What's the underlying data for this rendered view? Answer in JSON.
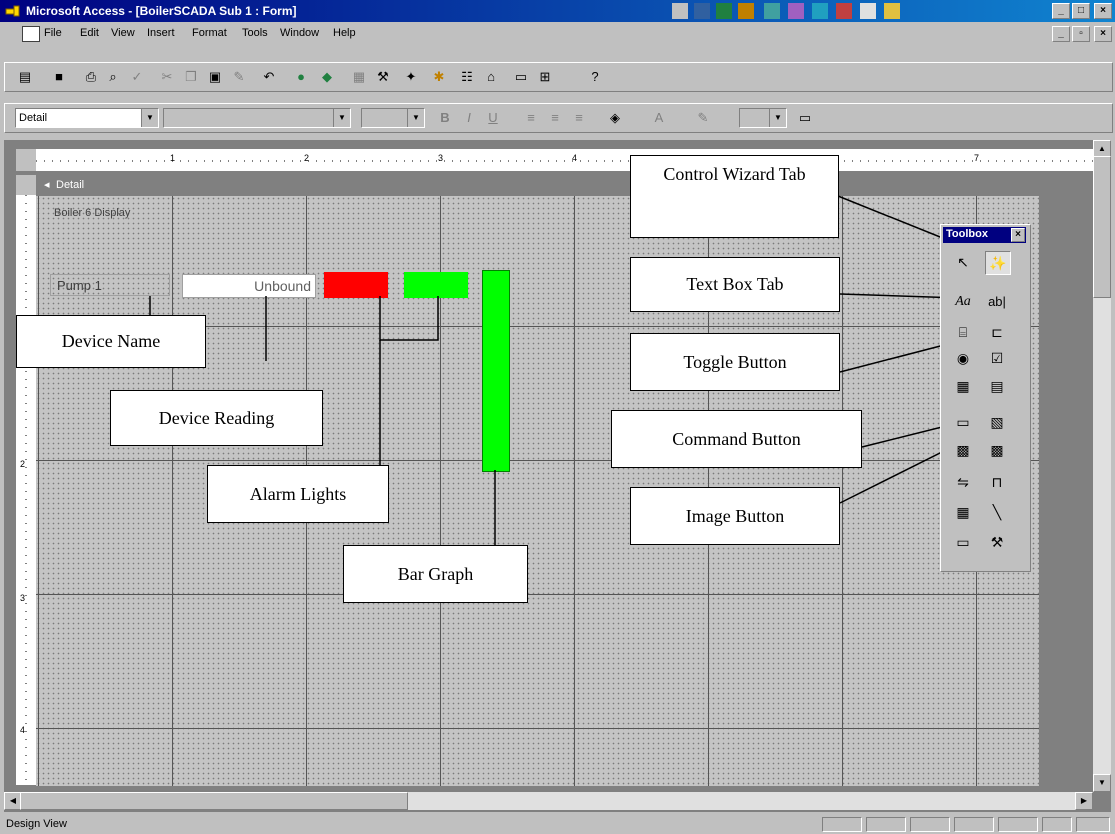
{
  "window": {
    "title": "Microsoft Access - [BoilerSCADA Sub 1 : Form]"
  },
  "menu": {
    "items": [
      "File",
      "Edit",
      "View",
      "Insert",
      "Format",
      "Tools",
      "Window",
      "Help"
    ]
  },
  "format_toolbar": {
    "object_combo": "Detail"
  },
  "section": {
    "header": "Detail"
  },
  "ruler": {
    "top_marks": [
      "1",
      "2",
      "3",
      "4",
      "7"
    ],
    "left_marks": [
      "2",
      "3",
      "4"
    ]
  },
  "form": {
    "label_title": "Boiler 6 Display",
    "label_device": "Pump 1",
    "textbox_value": "Unbound",
    "alarm_colors": [
      "#ff0000",
      "#00ff00"
    ],
    "bar_color": "#00ff00"
  },
  "toolbox": {
    "title": "Toolbox",
    "close": "×",
    "text_label": "Aa",
    "text_box": "ab|"
  },
  "callouts": {
    "device_name": "Device Name",
    "device_reading": "Device Reading",
    "alarm_lights": "Alarm Lights",
    "bar_graph": "Bar Graph",
    "control_wizard_tab": "Control Wizard Tab",
    "text_box_tab": "Text Box Tab",
    "toggle_button": "Toggle Button",
    "command_button": "Command Button",
    "image_button": "Image Button"
  },
  "status": {
    "text": "Design View"
  },
  "icons": {
    "app": "access-key-icon",
    "minimize": "minimize-icon",
    "maximize": "maximize-icon",
    "close": "close-icon"
  }
}
